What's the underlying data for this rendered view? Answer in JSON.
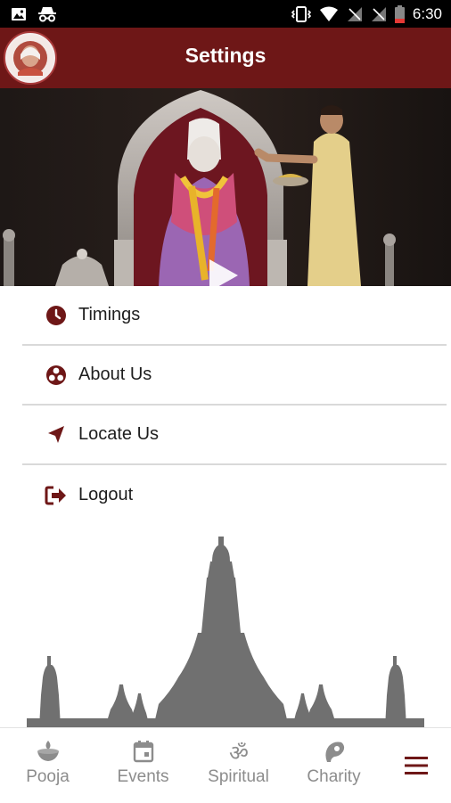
{
  "status_bar": {
    "time": "6:30"
  },
  "app_bar": {
    "title": "Settings"
  },
  "menu": {
    "items": [
      {
        "label": "Timings",
        "icon": "clock-icon"
      },
      {
        "label": "About Us",
        "icon": "biohazard-icon"
      },
      {
        "label": "Locate Us",
        "icon": "navigation-arrow-icon"
      },
      {
        "label": "Logout",
        "icon": "logout-icon"
      }
    ]
  },
  "bottom_nav": {
    "items": [
      {
        "label": "Pooja",
        "icon": "diya-icon"
      },
      {
        "label": "Events",
        "icon": "calendar-icon"
      },
      {
        "label": "Spiritual",
        "icon": "om-icon"
      },
      {
        "label": "Charity",
        "icon": "palm-icon"
      }
    ],
    "menu_icon": "hamburger-menu-icon"
  },
  "colors": {
    "accent": "#6e1717",
    "divider": "#d9d9d9",
    "nav_inactive": "#8c8c8c",
    "temple_silhouette": "#707070"
  }
}
